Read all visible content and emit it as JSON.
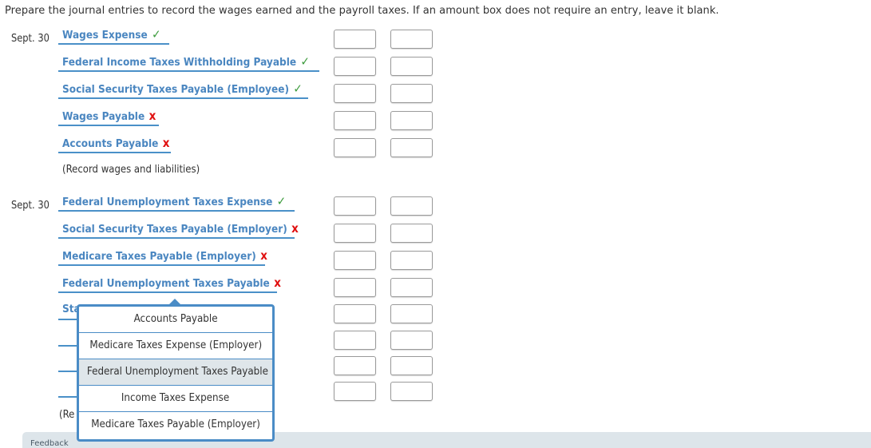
{
  "instructions": "Prepare the journal entries to record the wages earned and the payroll taxes. If an amount box does not require an entry, leave it blank.",
  "entries": [
    {
      "date": "Sept. 30",
      "note": "(Record wages and liabilities)",
      "rows": [
        {
          "account": "Wages Expense",
          "status": "correct",
          "mark": "✓"
        },
        {
          "account": "Federal Income Taxes Withholding Payable",
          "status": "correct",
          "mark": "✓"
        },
        {
          "account": "Social Security Taxes Payable (Employee)",
          "status": "correct",
          "mark": "✓"
        },
        {
          "account": "Wages Payable",
          "status": "incorrect",
          "mark": "x"
        },
        {
          "account": "Accounts Payable",
          "status": "incorrect",
          "mark": "x"
        }
      ]
    },
    {
      "date": "Sept. 30",
      "note": "(Re",
      "rows": [
        {
          "account": "Federal Unemployment Taxes Expense",
          "status": "correct",
          "mark": "✓"
        },
        {
          "account": "Social Security Taxes Payable (Employer)",
          "status": "incorrect",
          "mark": "x"
        },
        {
          "account": "Medicare Taxes Payable (Employer)",
          "status": "incorrect",
          "mark": "x"
        },
        {
          "account": "Federal Unemployment Taxes Payable",
          "status": "incorrect",
          "mark": "x"
        },
        {
          "account": "Sta",
          "status": "",
          "mark": ""
        },
        {
          "account": "",
          "status": "",
          "mark": ""
        },
        {
          "account": "",
          "status": "",
          "mark": ""
        },
        {
          "account": "",
          "status": "",
          "mark": ""
        }
      ]
    }
  ],
  "dropdown": {
    "options": [
      {
        "label": "Accounts Payable",
        "highlighted": false
      },
      {
        "label": "Medicare Taxes Expense (Employer)",
        "highlighted": false
      },
      {
        "label": "Federal Unemployment Taxes Payable",
        "highlighted": true
      },
      {
        "label": "Income Taxes Expense",
        "highlighted": false
      },
      {
        "label": "Medicare Taxes Payable (Employer)",
        "highlighted": false
      }
    ]
  },
  "feedback": {
    "label": "Feedback"
  },
  "colors": {
    "link": "#4a86c0",
    "underline": "#4a90c8",
    "correct": "#3a9a3a",
    "incorrect": "#e01010",
    "highlight": "#dfe6ea"
  }
}
